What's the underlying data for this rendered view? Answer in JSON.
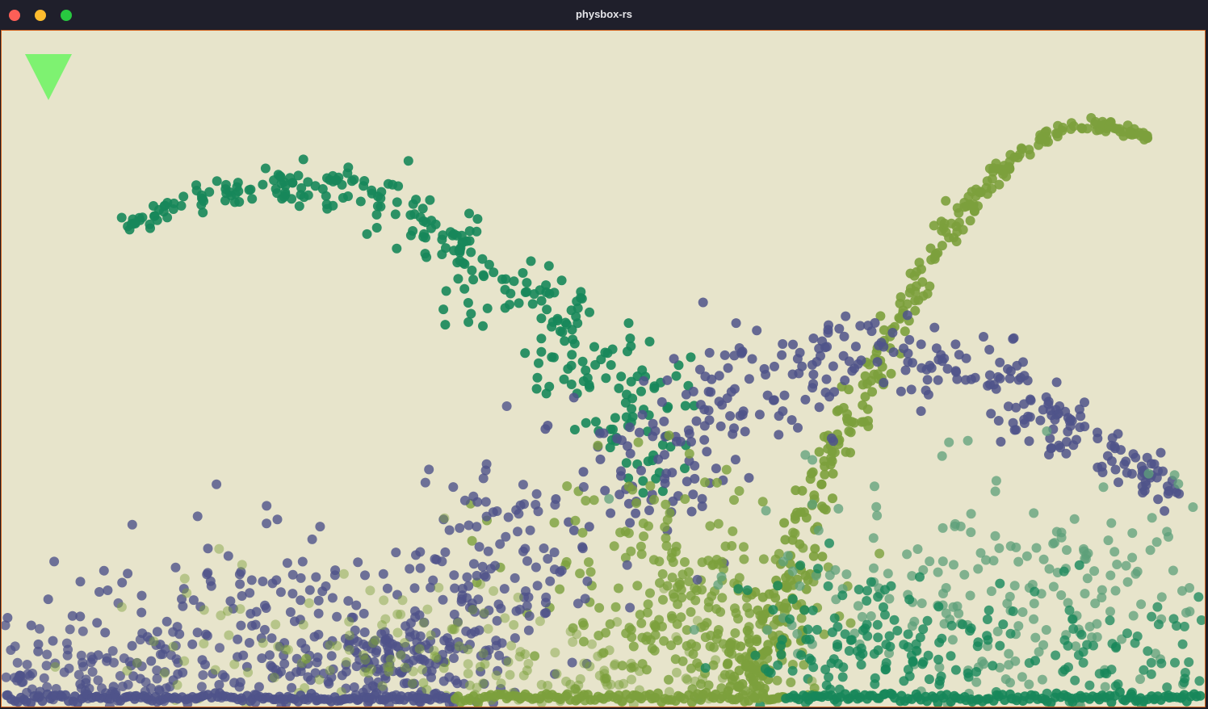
{
  "window": {
    "title": "physbox-rs",
    "controls": {
      "close_color": "#fe5f57",
      "minimize_color": "#febc2e",
      "maximize_color": "#28c840"
    }
  },
  "canvas": {
    "background": "#e7e4cb",
    "border_color": "#d2601c",
    "spawner_icon": "triangle-down-icon",
    "spawner_color": "#7ef271",
    "particle_colors": {
      "dark_green": "#17875a",
      "olive": "#7ca03c",
      "slate_blue": "#4f538a",
      "sage": "#5ea07a"
    }
  }
}
